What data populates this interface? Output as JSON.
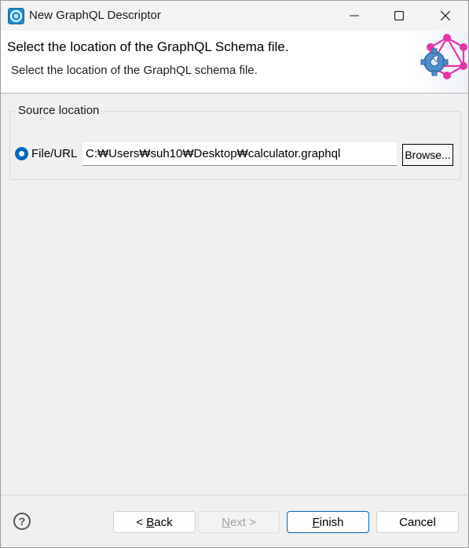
{
  "window": {
    "title": "New GraphQL Descriptor",
    "minimize_icon": "minimize-icon",
    "maximize_icon": "maximize-icon",
    "close_icon": "close-icon"
  },
  "banner": {
    "title": "Select the location of the GraphQL Schema file.",
    "description": "Select the location of the GraphQL schema file.",
    "logo_icon": "graphql-wizard-logo"
  },
  "source": {
    "group_label": "Source location",
    "radio_label": "File/URL",
    "radio_selected": true,
    "path_value": "C:₩Users₩suh10₩Desktop₩calculator.graphql",
    "browse_label": "Browse..."
  },
  "footer": {
    "help_icon": "help-icon",
    "back_mnemonic": "B",
    "back_rest": "ack",
    "back_prefix": "< ",
    "next_mnemonic": "N",
    "next_rest": "ext >",
    "finish_mnemonic": "F",
    "finish_rest": "inish",
    "cancel_label": "Cancel"
  },
  "colors": {
    "accent": "#0067c0",
    "graphql_pink": "#e535ab"
  }
}
